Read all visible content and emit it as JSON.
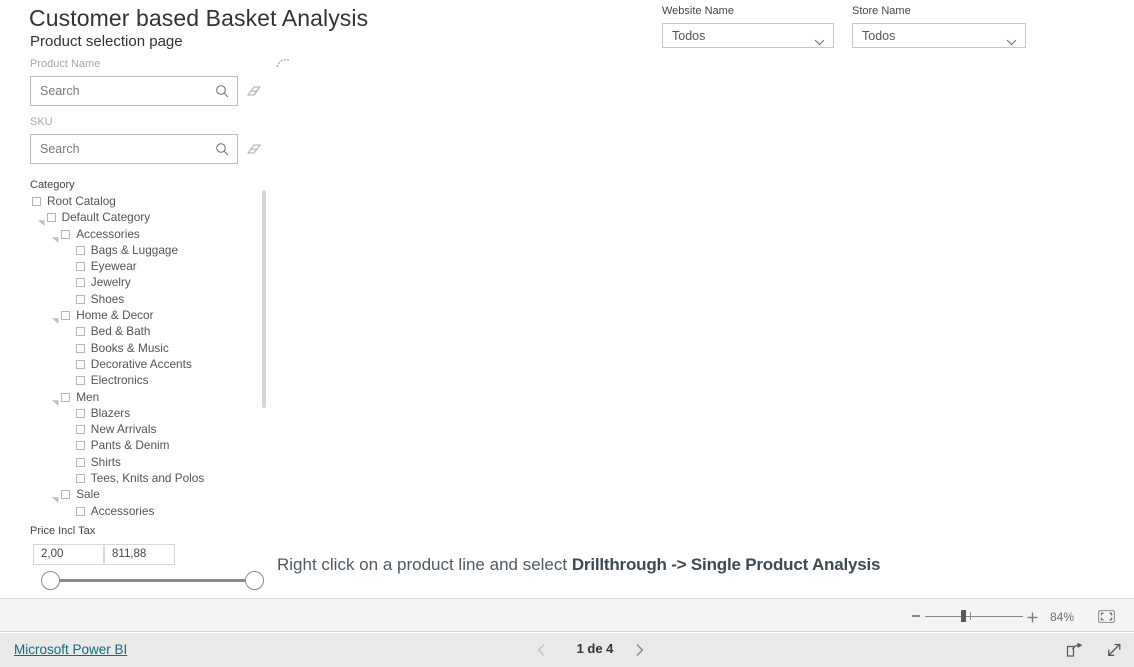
{
  "report": {
    "title": "Customer based Basket Analysis",
    "subtitle": "Product selection page"
  },
  "slicers": {
    "product_name": {
      "label": "Product Name",
      "placeholder": "Search",
      "value": "",
      "clear_icon": "eraser-icon"
    },
    "sku": {
      "label": "SKU",
      "placeholder": "Search",
      "value": "",
      "clear_icon": "eraser-icon"
    },
    "website_name": {
      "label": "Website Name",
      "value": "Todos"
    },
    "store_name": {
      "label": "Store Name",
      "value": "Todos"
    },
    "category": {
      "label": "Category",
      "nodes": [
        {
          "label": "Root Catalog",
          "level": 0,
          "expandable": true,
          "checked": false
        },
        {
          "label": "Default Category",
          "level": 1,
          "expandable": true,
          "checked": false
        },
        {
          "label": "Accessories",
          "level": 2,
          "expandable": true,
          "checked": false
        },
        {
          "label": "Bags & Luggage",
          "level": 3,
          "expandable": false,
          "checked": false
        },
        {
          "label": "Eyewear",
          "level": 3,
          "expandable": false,
          "checked": false
        },
        {
          "label": "Jewelry",
          "level": 3,
          "expandable": false,
          "checked": false
        },
        {
          "label": "Shoes",
          "level": 3,
          "expandable": false,
          "checked": false
        },
        {
          "label": "Home & Decor",
          "level": 2,
          "expandable": true,
          "checked": false
        },
        {
          "label": "Bed & Bath",
          "level": 3,
          "expandable": false,
          "checked": false
        },
        {
          "label": "Books & Music",
          "level": 3,
          "expandable": false,
          "checked": false
        },
        {
          "label": "Decorative Accents",
          "level": 3,
          "expandable": false,
          "checked": false
        },
        {
          "label": "Electronics",
          "level": 3,
          "expandable": false,
          "checked": false
        },
        {
          "label": "Men",
          "level": 2,
          "expandable": true,
          "checked": false
        },
        {
          "label": "Blazers",
          "level": 3,
          "expandable": false,
          "checked": false
        },
        {
          "label": "New Arrivals",
          "level": 3,
          "expandable": false,
          "checked": false
        },
        {
          "label": "Pants & Denim",
          "level": 3,
          "expandable": false,
          "checked": false
        },
        {
          "label": "Shirts",
          "level": 3,
          "expandable": false,
          "checked": false
        },
        {
          "label": "Tees, Knits and Polos",
          "level": 3,
          "expandable": false,
          "checked": false
        },
        {
          "label": "Sale",
          "level": 2,
          "expandable": true,
          "checked": false
        },
        {
          "label": "Accessories",
          "level": 3,
          "expandable": false,
          "checked": false
        }
      ]
    },
    "price_incl_tax": {
      "label": "Price Incl Tax",
      "min_value": "2,00",
      "max_value": "811,88"
    }
  },
  "instruction": {
    "prefix": "Right click on a product line and select ",
    "emphasis": "Drillthrough -> Single Product Analysis"
  },
  "zoombar": {
    "zoom_percent": "84%",
    "minus_label": "−",
    "plus_label": "+",
    "fit_icon": "fit-to-page-icon"
  },
  "footer": {
    "brand_link": "Microsoft Power BI",
    "page_indicator": "1 de 4",
    "prev_icon": "chevron-left-icon",
    "next_icon": "chevron-right-icon",
    "share_icon": "share-icon",
    "fullscreen_icon": "fullscreen-icon"
  },
  "colors": {
    "link": "#0e6e77",
    "instruction_text": "#4d5a63",
    "border": "#bfbfbf",
    "zoombar_bg": "#f4f4f4",
    "footer_bg": "#e9e9e9"
  }
}
